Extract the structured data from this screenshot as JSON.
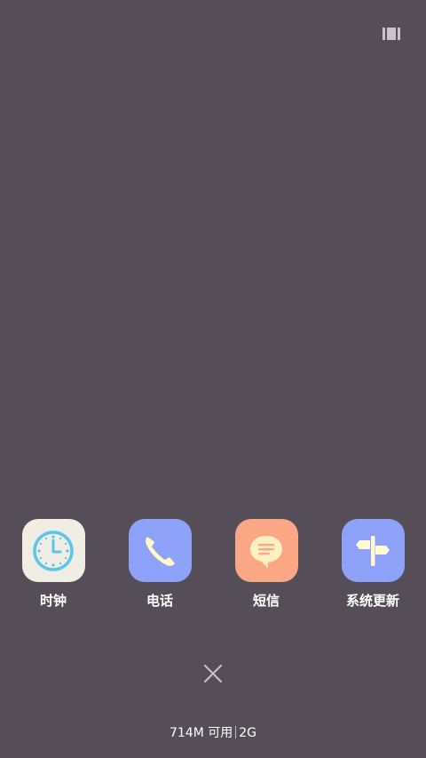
{
  "screen": {
    "background": "#554e58",
    "top_icon": "task-view-icon"
  },
  "apps": [
    {
      "label": "时钟",
      "icon": "clock-icon",
      "tile_color": "#f0ede5",
      "icon_color": "#5cc6e8"
    },
    {
      "label": "电话",
      "icon": "phone-icon",
      "tile_color": "#8ea2fa",
      "icon_color": "#fff7c4"
    },
    {
      "label": "短信",
      "icon": "message-icon",
      "tile_color": "#fba684",
      "icon_color": "#fff0c4"
    },
    {
      "label": "系统更新",
      "icon": "signpost-icon",
      "tile_color": "#8ea2fa",
      "icon_color": "#fff8d0"
    }
  ],
  "close_icon": "close-icon",
  "memory": {
    "available": "714M 可用",
    "total": "2G"
  }
}
